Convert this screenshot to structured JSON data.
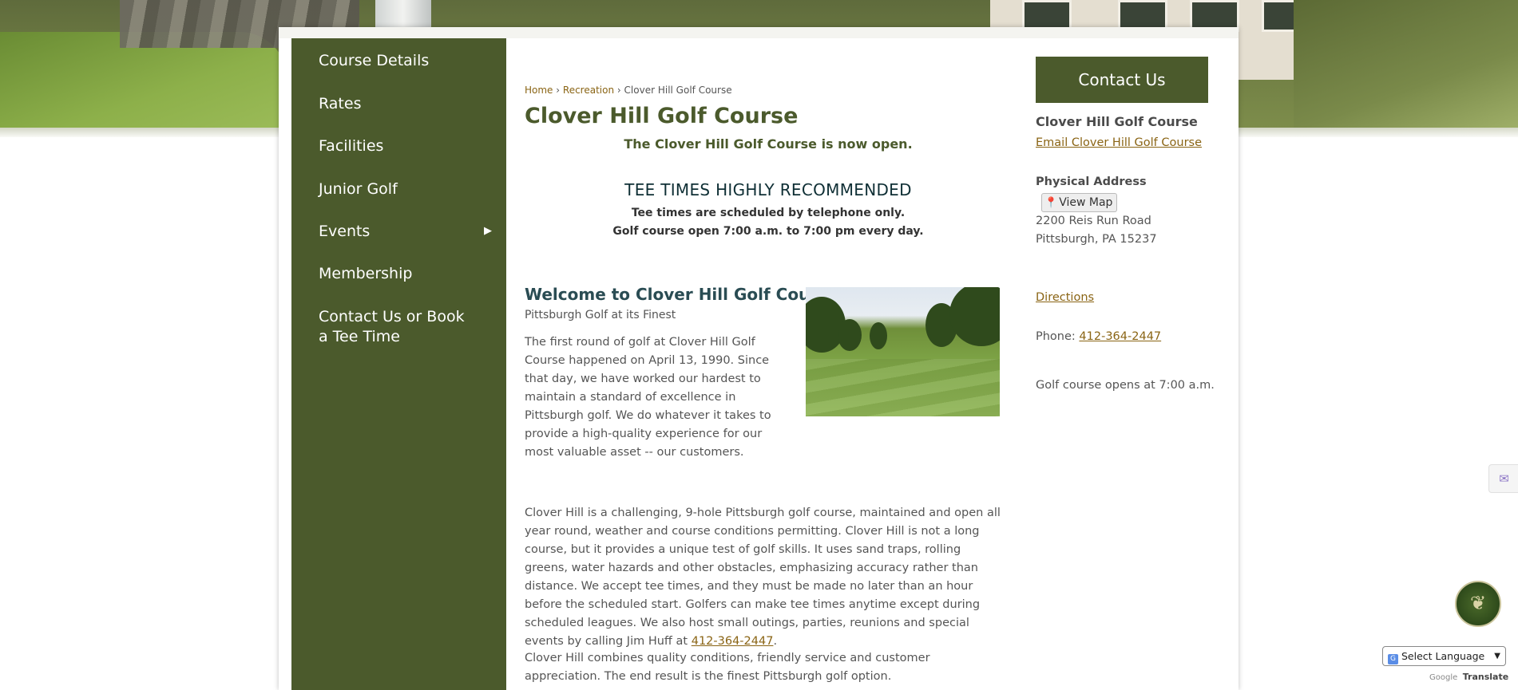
{
  "nav": {
    "items": [
      {
        "label": "Course Details"
      },
      {
        "label": "Rates"
      },
      {
        "label": "Facilities"
      },
      {
        "label": "Junior Golf"
      },
      {
        "label": "Events",
        "has_submenu": true,
        "arrow": "▶"
      },
      {
        "label": "Membership"
      },
      {
        "label": "Contact Us or Book a Tee Time"
      }
    ]
  },
  "breadcrumb": {
    "home": "Home",
    "recreation": "Recreation",
    "separator": "›",
    "current": "Clover Hill Golf Course"
  },
  "main": {
    "title": "Clover Hill Golf Course",
    "open_notice": "The Clover Hill Golf Course is now open.",
    "tee_heading": "TEE TIMES HIGHLY RECOMMENDED",
    "tee_line1": "Tee times are scheduled by telephone only.",
    "tee_line2": "Golf course open 7:00 a.m. to 7:00 pm every day.",
    "welcome_title": "Welcome to Clover Hill Golf Course",
    "welcome_subtitle": "Pittsburgh Golf at its Finest",
    "para1": "The first round of golf at Clover Hill Golf Course happened on April 13, 1990. Since that day, we have worked our hardest to maintain a standard of excellence in Pittsburgh golf. We do whatever it takes to provide a high-quality experience for our most valuable asset -- our customers.",
    "para2_text": "Clover Hill is a challenging, 9-hole Pittsburgh golf course, maintained and open all year round, weather and course conditions permitting. Clover Hill is not a long course, but it provides a unique test of golf skills. It uses sand traps, rolling greens, water hazards and other obstacles, emphasizing accuracy rather than distance. We accept tee times, and they must be made no later than an hour before the scheduled start. Golfers can make tee times anytime except during scheduled leagues. We also host small outings, parties, reunions and special events by calling Jim Huff at ",
    "para2_phone": "412-364-2447",
    "para2_end": ".",
    "para3": "Clover Hill combines quality conditions, friendly service and customer appreciation. The end result is the finest Pittsburgh golf option."
  },
  "contact": {
    "button_label": "Contact Us",
    "name": "Clover Hill Golf Course",
    "email_link": "Email Clover Hill Golf Course",
    "address_label": "Physical Address",
    "map_button": "View Map",
    "map_icon": "map-pin-icon",
    "address_line1": "2200 Reis Run Road",
    "address_line2": "Pittsburgh, PA 15237",
    "directions_link": "Directions",
    "phone_label": "Phone:",
    "phone": "412-364-2447",
    "hours_note": "Golf course opens at 7:00 a.m."
  },
  "widgets": {
    "language_select": "Select Language",
    "powered_by": "Google",
    "translate": "Translate"
  },
  "colors": {
    "brand_green": "#4b5a2c",
    "link_gold": "#8a6414",
    "heading_teal": "#2a4c53"
  }
}
